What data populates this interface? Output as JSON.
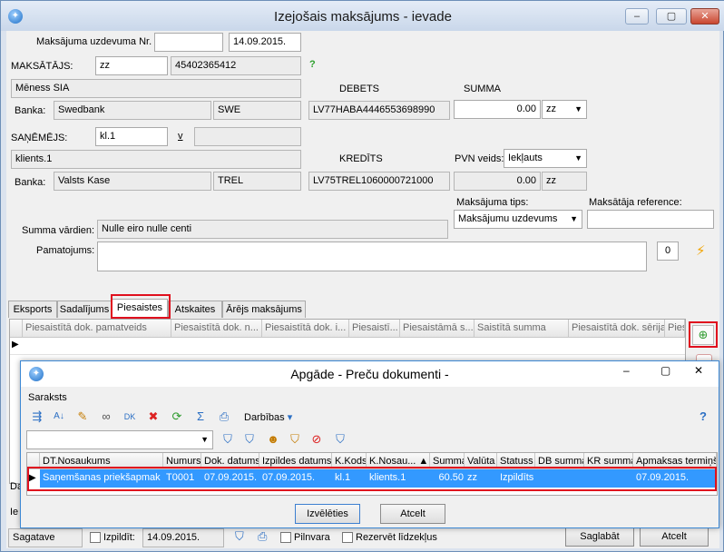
{
  "window": {
    "title": "Izejošais maksājums - ievade"
  },
  "form": {
    "order_nr_label": "Maksājuma uzdevuma Nr.",
    "order_nr_value": "",
    "order_date": "14.09.2015.",
    "payer_label": "MAKSĀTĀJS:",
    "payer_code": "zz",
    "payer_regnr": "45402365412",
    "payer_help": "?",
    "payer_name": "Mēness SIA",
    "bank_label": "Banka:",
    "payer_bank": "Swedbank",
    "payer_bank_code": "SWE",
    "debit_label": "DEBETS",
    "debit_account": "LV77HABA4446553698990",
    "sum_label": "SUMMA",
    "sum_value": "0.00",
    "sum_currency": "zz",
    "receiver_label": "SAŅĒMĒJS:",
    "receiver_code": "kl.1",
    "receiver_v": "v",
    "receiver_extra": "",
    "receiver_name": "klients.1",
    "receiver_bank": "Valsts Kase",
    "receiver_bank_code": "TREL",
    "credit_label": "KREDĪTS",
    "credit_account": "LV75TREL1060000721000",
    "vat_label": "PVN veids:",
    "vat_value": "Iekļauts",
    "vat_sum": "0.00",
    "vat_currency": "zz",
    "pay_type_label": "Maksājuma tips:",
    "pay_type_value": "Maksājumu uzdevums",
    "payer_ref_label": "Maksātāja reference:",
    "payer_ref_value": "",
    "sum_words_label": "Summa vārdien:",
    "sum_words_value": "Nulle eiro nulle centi",
    "basis_label": "Pamatojums:",
    "basis_value": "",
    "basis_count": "0"
  },
  "tabs": [
    "Eksports",
    "Sadalījums",
    "Piesaistes",
    "Atskaites",
    "Ārējs maksājums"
  ],
  "link_grid": {
    "columns": [
      "Piesaistītā dok. pamatveids",
      "Piesaistītā dok. n...",
      "Piesaistītā dok. i...",
      "Piesaistī...",
      "Piesaistāmā s...",
      "Saistītā summa",
      "Piesaistītā dok. sērija",
      "Piesa"
    ]
  },
  "bottom": {
    "left_label_1": "Da",
    "left_label_2": "Ie",
    "status": "Sagatave",
    "executed_label": "Izpildīt:",
    "executed_date": "14.09.2015.",
    "power_label": "Pilnvara",
    "reserve_label": "Rezervēt līdzekļus",
    "save_label": "Saglabāt",
    "cancel_label": "Atcelt"
  },
  "dialog": {
    "title": "Apgāde - Preču dokumenti -",
    "section": "Saraksts",
    "actions_label": "Darbības",
    "help": "?",
    "columns": [
      "DT.Nosaukums",
      "Numurs",
      "Dok. datums",
      "Izpildes datums",
      "K.Kods",
      "K.Nosau... ▲",
      "Summa",
      "Valūta",
      "Statuss",
      "DB summa",
      "KR summa",
      "Apmaksas termiņš"
    ],
    "rows": [
      [
        "Saņemšanas priekšapmaksa",
        "T0001",
        "07.09.2015.",
        "07.09.2015.",
        "kl.1",
        "klients.1",
        "60.50",
        "zz",
        "Izpildīts",
        "",
        "",
        "07.09.2015."
      ]
    ],
    "choose_label": "Izvēlēties",
    "cancel_label": "Atcelt"
  },
  "colors": {
    "selection": "#3399ff",
    "highlight": "#e0101e",
    "accent": "#1e6fc7"
  }
}
